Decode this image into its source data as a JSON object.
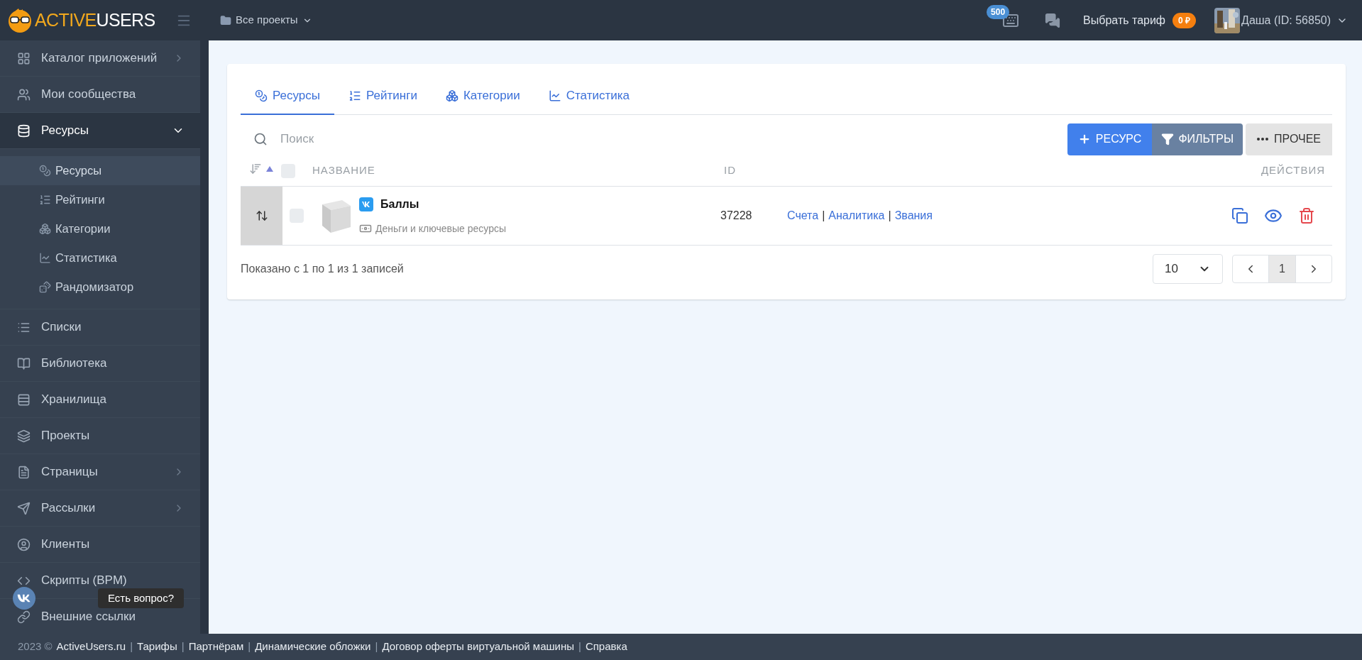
{
  "topbar": {
    "logo_part1": "ACTIVE",
    "logo_part2": "USERS",
    "project_selector": "Все проекты",
    "keyboard_badge": "500",
    "tariff_button": "Выбрать тариф",
    "balance_badge": "0 ₽",
    "user": "Даша (ID: 56850)"
  },
  "sidebar": {
    "items": [
      {
        "label": "Каталог приложений",
        "has_submenu": true,
        "expanded": false
      },
      {
        "label": "Мои сообщества",
        "has_submenu": false,
        "expanded": false
      },
      {
        "label": "Ресурсы",
        "has_submenu": true,
        "expanded": true,
        "children": [
          {
            "label": "Ресурсы",
            "selected": true
          },
          {
            "label": "Рейтинги",
            "selected": false
          },
          {
            "label": "Категории",
            "selected": false
          },
          {
            "label": "Статистика",
            "selected": false
          },
          {
            "label": "Рандомизатор",
            "selected": false
          }
        ]
      },
      {
        "label": "Списки",
        "has_submenu": false,
        "expanded": false
      },
      {
        "label": "Библиотека",
        "has_submenu": false,
        "expanded": false
      },
      {
        "label": "Хранилища",
        "has_submenu": false,
        "expanded": false
      },
      {
        "label": "Проекты",
        "has_submenu": false,
        "expanded": false
      },
      {
        "label": "Страницы",
        "has_submenu": true,
        "expanded": false
      },
      {
        "label": "Рассылки",
        "has_submenu": true,
        "expanded": false
      },
      {
        "label": "Клиенты",
        "has_submenu": false,
        "expanded": false
      },
      {
        "label": "Скрипты (BPM)",
        "has_submenu": false,
        "expanded": false
      },
      {
        "label": "Внешние ссылки",
        "has_submenu": false,
        "expanded": false
      }
    ]
  },
  "tabs": [
    {
      "label": "Ресурсы",
      "selected": true
    },
    {
      "label": "Рейтинги",
      "selected": false
    },
    {
      "label": "Категории",
      "selected": false
    },
    {
      "label": "Статистика",
      "selected": false
    }
  ],
  "toolbar": {
    "search": {
      "placeholder": "Поиск"
    },
    "add_button": "РЕСУРС",
    "filter_button": "ФИЛЬТРЫ",
    "more_button": "ПРОЧЕЕ"
  },
  "table": {
    "columns": [
      "НАЗВАНИЕ",
      "ID",
      "ДЕЙСТВИЯ"
    ],
    "all_checked": false,
    "rows": [
      {
        "name": "Баллы",
        "category": "Деньги и ключевые ресурсы",
        "id": "37228",
        "links": [
          "Счета",
          "Аналитика",
          "Звания"
        ],
        "link_separator": "|",
        "checked": false
      }
    ]
  },
  "pagination": {
    "info": "Показано с 1 по 1 из 1 записей",
    "page_size": "10",
    "pages": [
      {
        "label": "1",
        "selected": true
      }
    ]
  },
  "chat": {
    "label": "Есть вопрос?"
  },
  "footer": {
    "copyright": "2023 ©",
    "links": [
      "ActiveUsers.ru",
      "Тарифы",
      "Партнёрам",
      "Динамические обложки",
      "Договор оферты виртуальной машины",
      "Справка"
    ],
    "separator": "|"
  }
}
